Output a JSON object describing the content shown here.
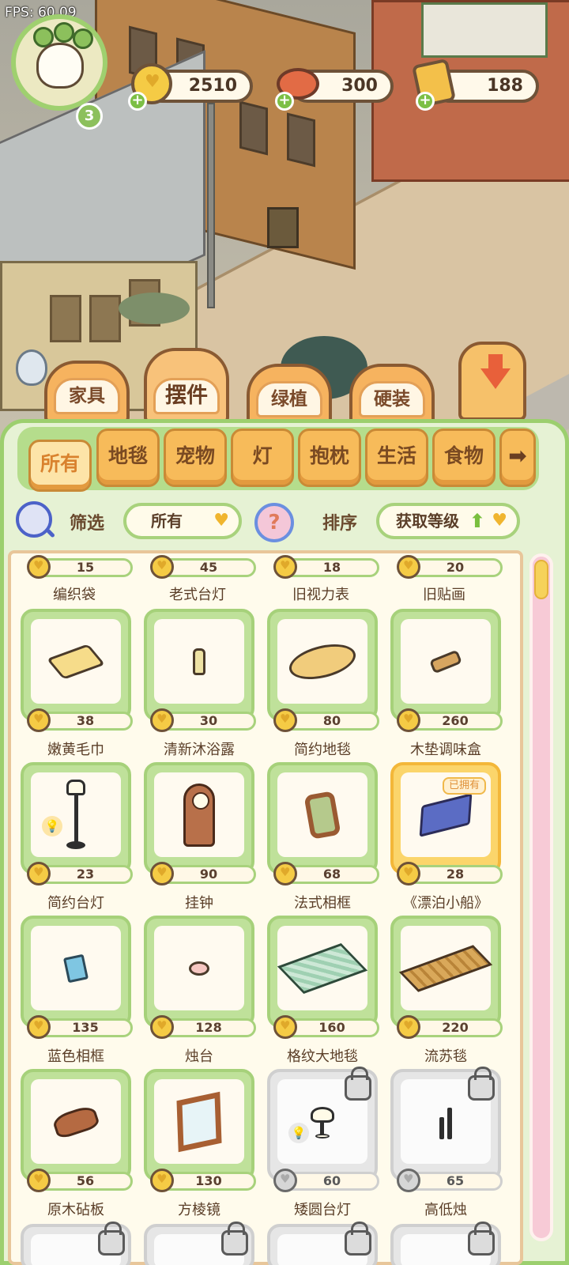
{
  "fps": "FPS: 60.09",
  "player": {
    "level": "3"
  },
  "resources": {
    "coins": "2510",
    "meat": "300",
    "tickets": "188"
  },
  "tabs": [
    "家具",
    "摆件",
    "绿植",
    "硬装"
  ],
  "active_tab": "摆件",
  "subtabs": [
    "所有",
    "地毯",
    "宠物",
    "灯",
    "抱枕",
    "生活",
    "食物"
  ],
  "active_subtab": "所有",
  "filter": {
    "label": "筛选",
    "value": "所有"
  },
  "sort": {
    "label": "排序",
    "value": "获取等级"
  },
  "owned_label": "已拥有",
  "top_row": [
    {
      "price": "15",
      "name": "编织袋"
    },
    {
      "price": "45",
      "name": "老式台灯"
    },
    {
      "price": "18",
      "name": "旧视力表"
    },
    {
      "price": "20",
      "name": "旧贴画"
    }
  ],
  "items": [
    {
      "price": "38",
      "name": "嫩黄毛巾",
      "art": "towel-icon"
    },
    {
      "price": "30",
      "name": "清新沐浴露",
      "art": "bottle-icon"
    },
    {
      "price": "80",
      "name": "简约地毯",
      "art": "rug-icon"
    },
    {
      "price": "260",
      "name": "木垫调味盒",
      "art": "spice-box-icon"
    },
    {
      "price": "23",
      "name": "简约台灯",
      "art": "floor-lamp-icon"
    },
    {
      "price": "90",
      "name": "挂钟",
      "art": "clock-icon"
    },
    {
      "price": "68",
      "name": "法式相框",
      "art": "frame-icon"
    },
    {
      "price": "28",
      "name": "《漂泊小船》",
      "art": "book-icon"
    },
    {
      "price": "135",
      "name": "蓝色相框",
      "art": "blue-frame-icon"
    },
    {
      "price": "128",
      "name": "烛台",
      "art": "candle-icon"
    },
    {
      "price": "160",
      "name": "格纹大地毯",
      "art": "plaid-rug-icon"
    },
    {
      "price": "220",
      "name": "流苏毯",
      "art": "tassel-rug-icon"
    },
    {
      "price": "56",
      "name": "原木砧板",
      "art": "board-icon"
    },
    {
      "price": "130",
      "name": "方棱镜",
      "art": "mirror-icon"
    },
    {
      "price": "60",
      "name": "矮圆台灯",
      "art": "round-lamp-icon"
    },
    {
      "price": "65",
      "name": "高低烛",
      "art": "candles-icon"
    }
  ]
}
